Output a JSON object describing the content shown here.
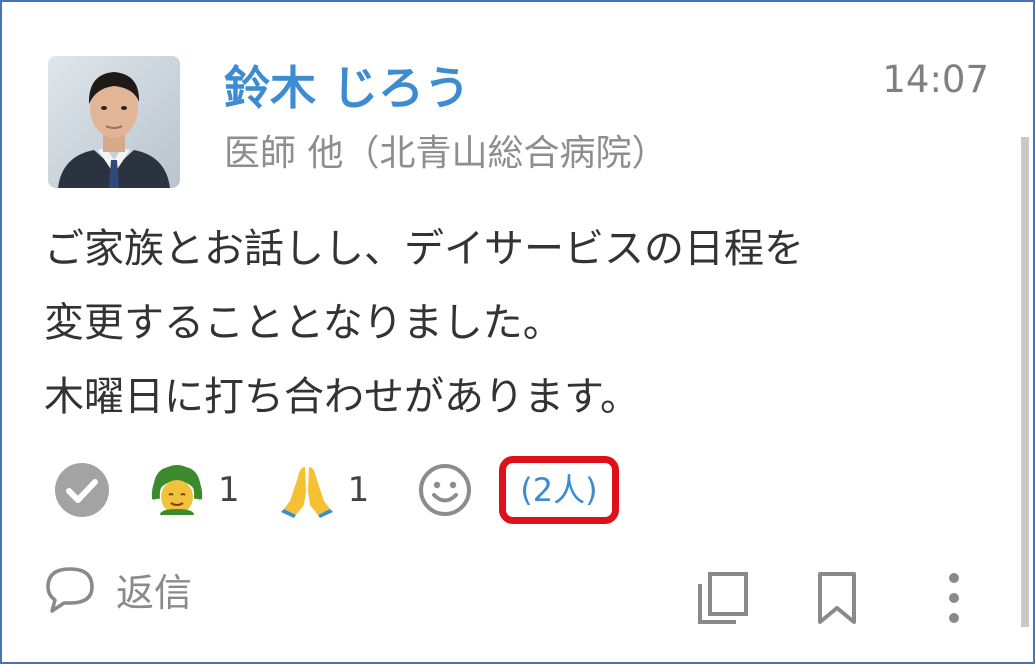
{
  "post": {
    "author_name": "鈴木 じろう",
    "author_role": "医師 他（北青山総合病院）",
    "time": "14:07",
    "message_lines": [
      "ご家族とお話しし、デイサービスの日程を",
      "変更することとなりました。",
      "木曜日に打ち合わせがあります。"
    ]
  },
  "reactions": {
    "items": [
      {
        "icon": "check-circle-icon"
      },
      {
        "icon": "ok-gesture-icon",
        "count": "1"
      },
      {
        "icon": "folded-hands-icon",
        "count": "1"
      }
    ],
    "add_icon": "smiley-icon",
    "people_label": "(2人)",
    "highlight_color": "#e0101a"
  },
  "actions": {
    "reply_label": "返信",
    "reply_icon": "speech-bubble-icon",
    "copy_icon": "copy-icon",
    "bookmark_icon": "bookmark-icon",
    "more_icon": "more-vertical-icon"
  },
  "colors": {
    "accent": "#3d8bd0",
    "frame": "#4a72b8",
    "muted": "#8e8e8e"
  }
}
